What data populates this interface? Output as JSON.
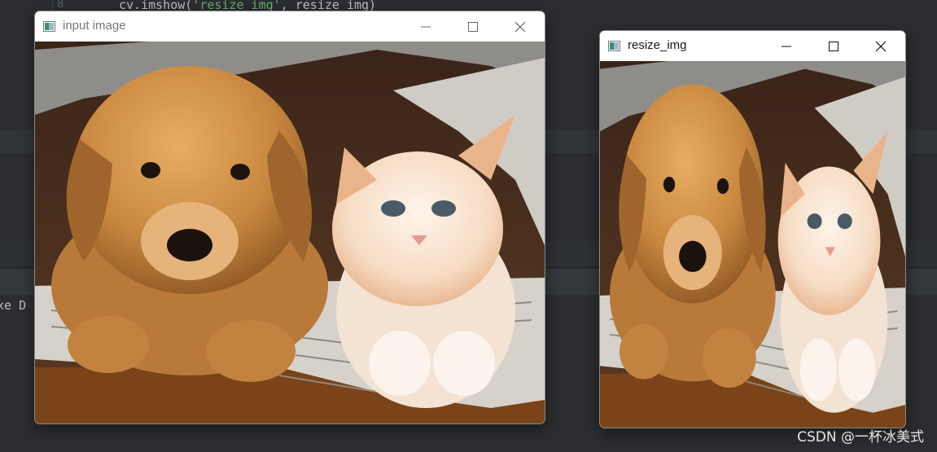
{
  "editor": {
    "line_number": "8",
    "code_prefix": "cv.imshow(",
    "code_string": "'resize_img'",
    "code_suffix": ", resize_img)",
    "console_text": "xe D"
  },
  "windows": [
    {
      "title": "input image",
      "title_color": "#777777"
    },
    {
      "title": "resize_img",
      "title_color": "#1a1a1a"
    }
  ],
  "watermark": "CSDN @一杯冰美式",
  "colors": {
    "ide_background": "#2b2d30",
    "window_background": "#ffffff",
    "puppy_fur": "#c8873f",
    "kitten_fur": "#f1c7a0",
    "newspaper": "#d6d2cb"
  },
  "icons": {
    "app_icon": "opencv-window-icon",
    "minimize": "minimize-icon",
    "maximize": "maximize-icon",
    "close": "close-icon"
  }
}
